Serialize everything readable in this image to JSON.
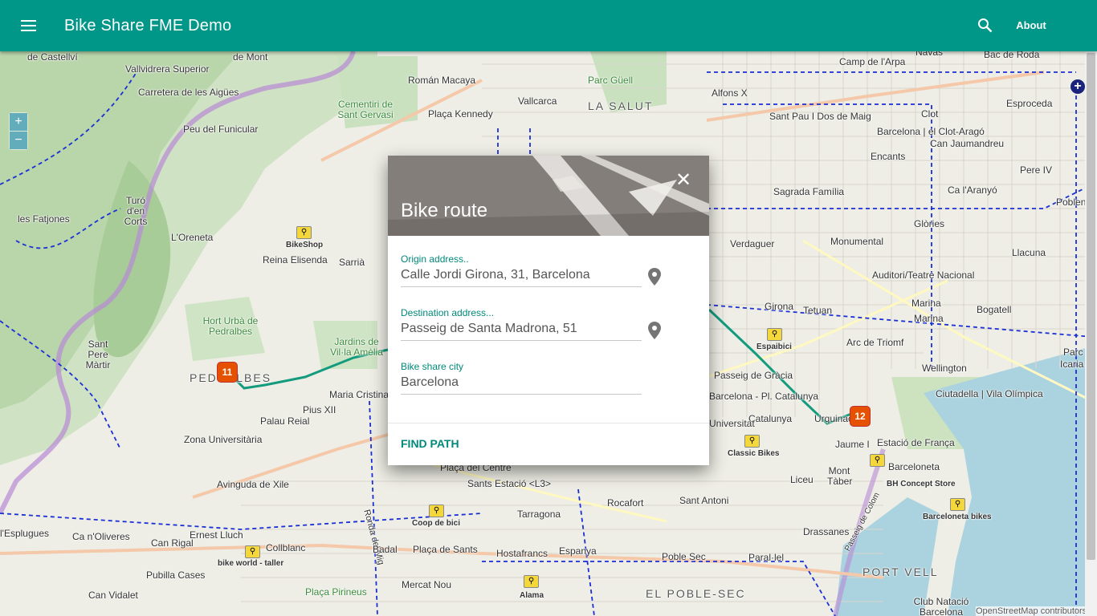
{
  "app": {
    "title": "Bike Share FME Demo",
    "about_label": "About"
  },
  "map": {
    "zoom_in": "+",
    "zoom_out": "−",
    "layers_symbol": "+",
    "labels": [
      "de Castellví",
      "de Mont",
      "Vallvidrera Superior",
      "Carretera de les Aigües",
      "Peu del Funicular",
      "Turó d'en Corts",
      "les Fatjones",
      "L'Oreneta",
      "Reina Elisenda",
      "Sarrià",
      "BikeShop",
      "Cementiri de Sant Gervasi",
      "Román Macaya",
      "Parc Güell",
      "Vallcarca",
      "LA SALUT",
      "Plaça Kennedy",
      "Alfons X",
      "Camp de l'Arpa",
      "Navas",
      "Bac de Roda",
      "Sant Pau I Dos de Maig",
      "Clot",
      "Esproceda",
      "Barcelona | el Clot-Aragó",
      "Can Jaumandreu",
      "Encants",
      "Pere IV",
      "Sagrada Família",
      "Ca l'Aranyó",
      "Poblen",
      "Glòries",
      "Verdaguer",
      "Monumental",
      "Llacuna",
      "Auditori/Teatre Nacional",
      "Girona",
      "Tetuan",
      "Marina",
      "Bogatell",
      "Marina",
      "Espaibici",
      "Arc de Triomf",
      "Parc de N",
      "Icaria",
      "Wellington",
      "Passeig de Gràcia",
      "Barcelona - Pl. Catalunya",
      "Catalunya",
      "Ciutadella | Vila Olímpica",
      "Urquinaona",
      "Jaume I",
      "Estació de França",
      "Universitat",
      "Classic Bikes",
      "Barceloneta",
      "Mont Tàber",
      "BH Concept Store",
      "Liceu",
      "Barceloneta bikes",
      "Sant Antoni",
      "Drassanes",
      "Paral·lel",
      "Poble Sec",
      "PORT VELL",
      "Club Natació Barcelona",
      "Hort Urbà de Pedralbes",
      "Jardins de Vil·la Amèlia",
      "Sant Pere Màrtir",
      "PEDRALBES",
      "Maria Cristina",
      "Pius XII",
      "Palau Reial",
      "Zona Universitària",
      "Avinguda de Xile",
      "Plaça del Centre",
      "Sants Estació <L3>",
      "Tarragona",
      "Rocafort",
      "Coop de bici",
      "Ronda del Mig",
      "l'Esplugues",
      "Ca n'Oliveres",
      "Can Rigal",
      "Ernest Lluch",
      "Collblanc",
      "Badal",
      "Plaça de Sants",
      "Hostafrancs",
      "Espanya",
      "Pubilla Cases",
      "bike world - taller",
      "Can Vidalet",
      "Plaça Pirineus",
      "Mercat Nou",
      "Alama",
      "EL POBLE-SEC",
      "Passeig de Colom",
      "OpenStreetMap contributors"
    ],
    "markers": [
      {
        "label": "11",
        "name": "route-origin-station-marker"
      },
      {
        "label": "12",
        "name": "route-destination-station-marker"
      }
    ]
  },
  "dialog": {
    "title": "Bike route",
    "close_symbol": "✕",
    "origin": {
      "label": "Origin address..",
      "value": "Calle Jordi Girona, 31, Barcelona"
    },
    "destination": {
      "label": "Destination address...",
      "value": "Passeig de Santa Madrona, 51"
    },
    "city": {
      "label": "Bike share city",
      "value": "Barcelona"
    },
    "find_label": "FIND PATH"
  },
  "colors": {
    "appbar": "#009688",
    "accent": "#00897b",
    "route": "#139b7e",
    "marker": "#e65100"
  }
}
